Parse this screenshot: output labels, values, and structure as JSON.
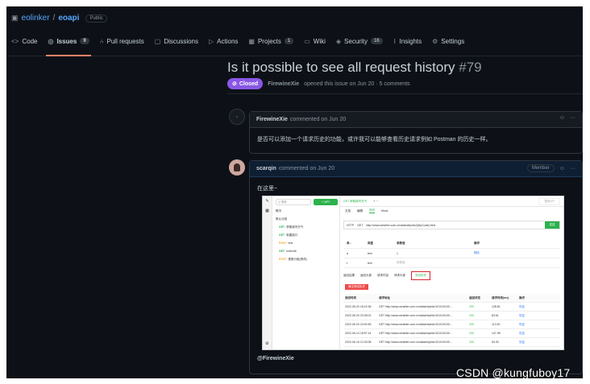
{
  "repo": {
    "owner": "eolinker",
    "name": "eoapi",
    "visibility": "Public"
  },
  "nav": [
    {
      "label": "Code",
      "icon": "<>"
    },
    {
      "label": "Issues",
      "count": "9",
      "icon": "◎",
      "active": true
    },
    {
      "label": "Pull requests",
      "icon": "⑃"
    },
    {
      "label": "Discussions",
      "icon": "▢"
    },
    {
      "label": "Actions",
      "icon": "▷"
    },
    {
      "label": "Projects",
      "count": "1",
      "icon": "▦"
    },
    {
      "label": "Wiki",
      "icon": "▭"
    },
    {
      "label": "Security",
      "count": "16",
      "icon": "◈"
    },
    {
      "label": "Insights",
      "icon": "⌇"
    },
    {
      "label": "Settings",
      "icon": "⚙"
    }
  ],
  "issue": {
    "title": "Is it possible to see all request history",
    "number": "#79",
    "state": "Closed",
    "author": "FirewineXie",
    "opened_text": "opened this issue on Jun 20 · 5 comments"
  },
  "comments": [
    {
      "author": "FirewineXie",
      "time": "commented on Jun 20",
      "body": "是否可以添加一个请求历史的功能，或许我可以能够查看历史请求例如 Postman 的历史一样。"
    },
    {
      "author": "scarqin",
      "time": "commented on Jun 20",
      "role": "Member",
      "body": "在这里~",
      "mention": "@FirewineXie"
    }
  ],
  "screenshot": {
    "search_placeholder": "Q 搜索",
    "api_button": "+ API",
    "tree": [
      {
        "label": "概况",
        "method": ""
      },
      {
        "label": "默认分组",
        "method": ""
      },
      {
        "method": "GET",
        "label": "获取城市天气"
      },
      {
        "method": "GET",
        "label": "新建接口"
      },
      {
        "method": "POST",
        "label": "test"
      },
      {
        "method": "GET",
        "label": "Indexdb"
      },
      {
        "method": "POST",
        "label": "更新分组(修改)"
      }
    ],
    "top_tab": "GET 获取城市天气",
    "top_search": "搜索API",
    "subtabs": [
      "文档",
      "编辑",
      "测试",
      "Mock"
    ],
    "protocol": "HTTP",
    "method": "GET",
    "url": "http://www.weather.com.cn/data/cityinfo/{cityCode}.html",
    "send": "发送",
    "param_headers": [
      "参...",
      "类型",
      "参数值",
      "操作"
    ],
    "param_rows": [
      {
        "name": "a",
        "type": "text",
        "value": "1",
        "op": "删除"
      },
      {
        "name": "t",
        "type": "text",
        "value": "参数值",
        "op": ""
      }
    ],
    "result_tabs": [
      "返回结果",
      "返回头部",
      "请求内容",
      "请求头部",
      "测试历史"
    ],
    "clear": "清空测试历史",
    "history_headers": [
      "测试时间",
      "请求地址",
      "返回状态",
      "请求时间(ms)",
      "操作"
    ],
    "history": [
      {
        "time": "2022-05-20 18:21:06",
        "url": "GET http://www.weather.com.cn/data/cityinfo/101010100...",
        "status": "200",
        "ms": "128.81",
        "op": "恢复"
      },
      {
        "time": "2022-05-20 23:35:01",
        "url": "GET http://www.weather.com.cn/data/cityinfo/101010100...",
        "status": "200",
        "ms": "83.61",
        "op": "恢复"
      },
      {
        "time": "2022-05-20 23:52:53",
        "url": "GET http://www.weather.com.cn/data/cityinfo/101010100...",
        "status": "200",
        "ms": "113.90",
        "op": "恢复"
      },
      {
        "time": "2022-06-14 18:57:14",
        "url": "GET http://www.weather.com.cn/data/cityinfo/101010100...",
        "status": "200",
        "ms": "147.98",
        "op": "恢复"
      },
      {
        "time": "2022-06-16 12:33:38",
        "url": "GET http://www.weather.com.cn/data/cityinfo/101010100...",
        "status": "200",
        "ms": "84.30",
        "op": "恢复"
      }
    ]
  },
  "watermark": "CSDN @kungfuboy17"
}
